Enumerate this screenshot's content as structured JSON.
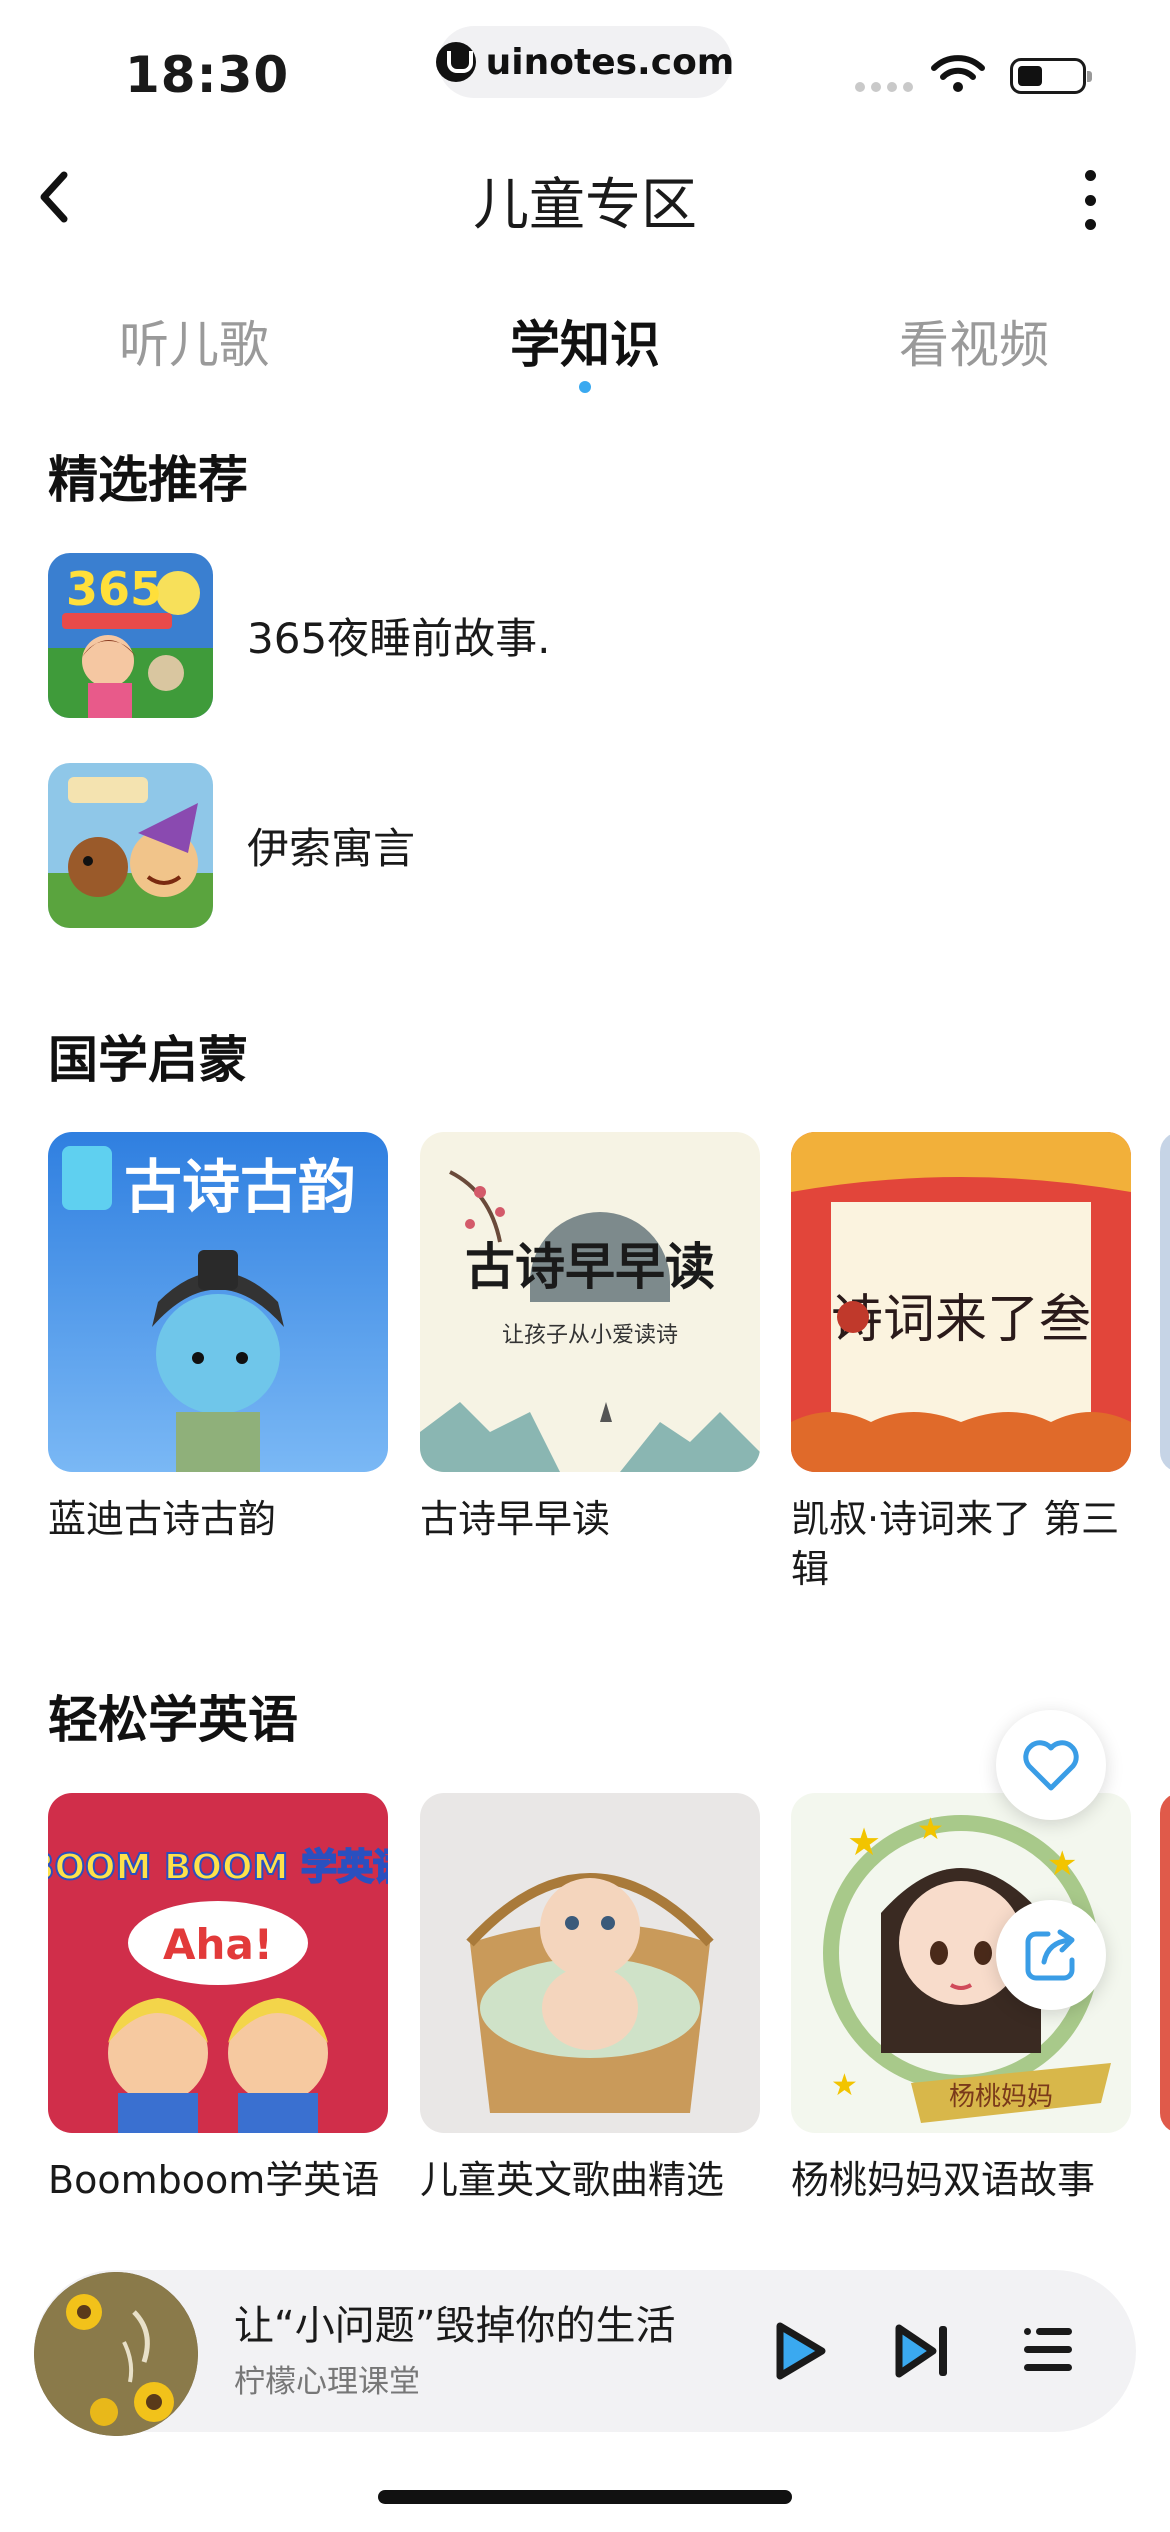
{
  "status_bar": {
    "time": "18:30",
    "url": "uinotes.com"
  },
  "header": {
    "title": "儿童专区"
  },
  "tabs": [
    {
      "label": "听儿歌",
      "active": false
    },
    {
      "label": "学知识",
      "active": true
    },
    {
      "label": "看视频",
      "active": false
    }
  ],
  "featured": {
    "title": "精选推荐",
    "items": [
      {
        "label": "365夜睡前故事."
      },
      {
        "label": "伊索寓言"
      }
    ]
  },
  "guoxue": {
    "title": "国学启蒙",
    "cards": [
      {
        "label": "蓝迪古诗古韵",
        "cover_text": "古诗古韵"
      },
      {
        "label": "古诗早早读",
        "cover_text": "古诗早早读",
        "cover_sub": "让孩子从小爱读诗"
      },
      {
        "label": "凯叔·诗词来了 第三辑",
        "cover_text": "诗词来了叁"
      }
    ]
  },
  "english": {
    "title": "轻松学英语",
    "cards": [
      {
        "label": "Boomboom学英语",
        "cover_text": "BOOM BOOM 学英语",
        "cover_sub": "Aha!"
      },
      {
        "label": "儿童英文歌曲精选"
      },
      {
        "label": "杨桃妈妈双语故事",
        "cover_text": "杨桃妈妈"
      }
    ]
  },
  "player": {
    "title": "让“小问题”毁掉你的生活",
    "subtitle": "柠檬心理课堂"
  },
  "colors": {
    "accent": "#3aa9f0",
    "text": "#1a1a1a",
    "muted": "#9a9a9a"
  }
}
